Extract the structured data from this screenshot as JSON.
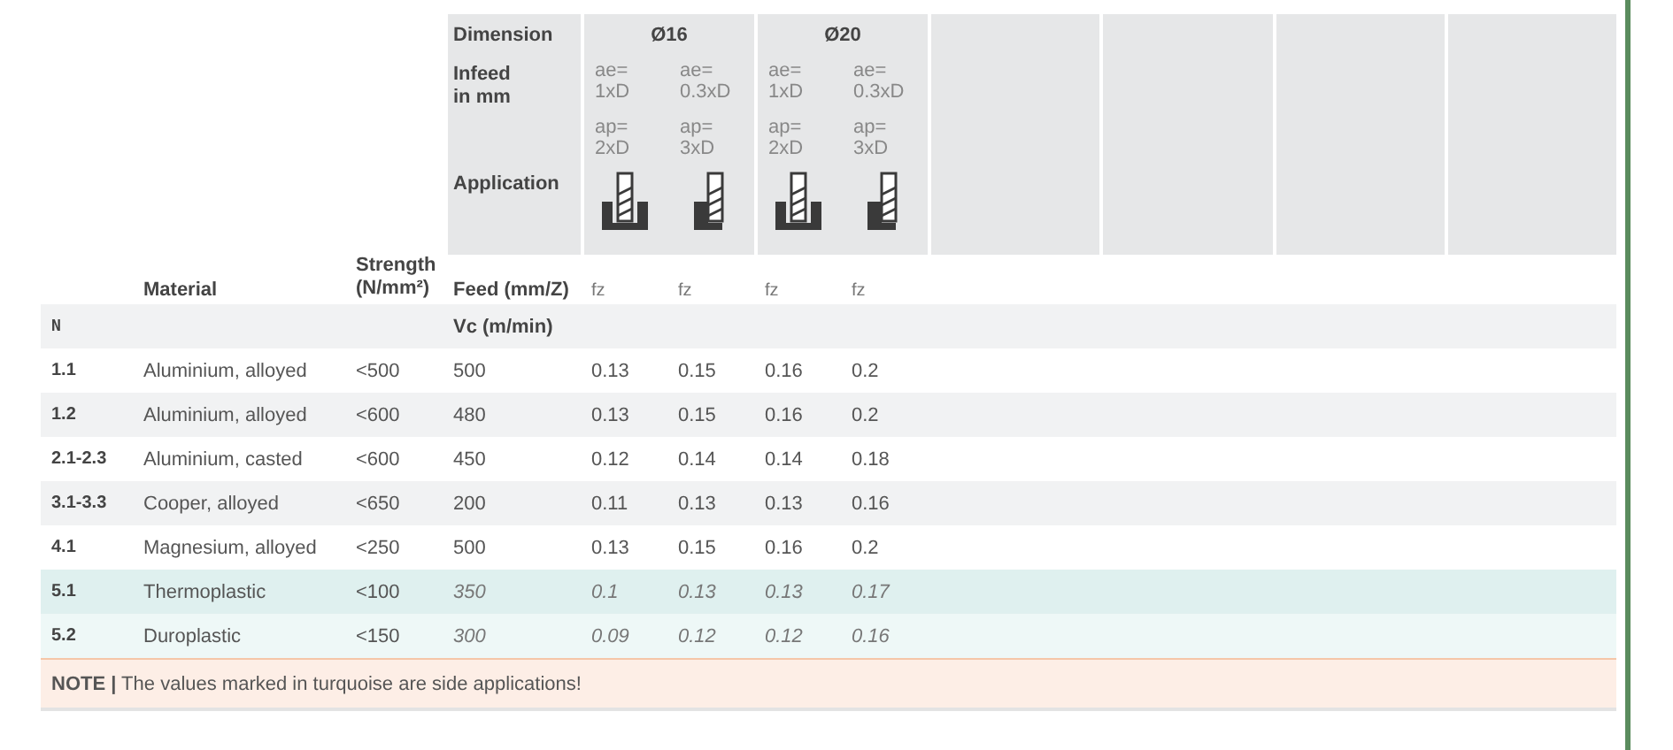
{
  "header": {
    "dimension_label": "Dimension",
    "infeed_label": "Infeed\nin mm",
    "application_label": "Application",
    "groups": [
      {
        "title": "Ø16",
        "columns": [
          {
            "ae": "ae=\n1xD",
            "ap": "ap=\n2xD",
            "application": {
              "kind": "slot"
            }
          },
          {
            "ae": "ae=\n0.3xD",
            "ap": "ap=\n3xD",
            "application": {
              "kind": "shoulder"
            }
          }
        ]
      },
      {
        "title": "Ø20",
        "columns": [
          {
            "ae": "ae=\n1xD",
            "ap": "ap=\n2xD",
            "application": {
              "kind": "slot"
            }
          },
          {
            "ae": "ae=\n0.3xD",
            "ap": "ap=\n3xD",
            "application": {
              "kind": "shoulder"
            }
          }
        ]
      }
    ]
  },
  "feed_row": {
    "material_label": "Material",
    "strength_label": "Strength\n(N/mm²)",
    "feed_label": "Feed (mm/Z)",
    "units": [
      "fz",
      "fz",
      "fz",
      "fz"
    ]
  },
  "section_row": {
    "code": "N",
    "vc_label": "Vc (m/min)"
  },
  "rows": [
    {
      "code": "1.1",
      "material": "Aluminium, alloyed",
      "strength": "<500",
      "vc": "500",
      "values": [
        "0.13",
        "0.15",
        "0.16",
        "0.2"
      ],
      "kind": "normal"
    },
    {
      "code": "1.2",
      "material": "Aluminium, alloyed",
      "strength": "<600",
      "vc": "480",
      "values": [
        "0.13",
        "0.15",
        "0.16",
        "0.2"
      ],
      "kind": "normal"
    },
    {
      "code": "2.1-2.3",
      "material": "Aluminium, casted",
      "strength": "<600",
      "vc": "450",
      "values": [
        "0.12",
        "0.14",
        "0.14",
        "0.18"
      ],
      "kind": "normal"
    },
    {
      "code": "3.1-3.3",
      "material": "Cooper, alloyed",
      "strength": "<650",
      "vc": "200",
      "values": [
        "0.11",
        "0.13",
        "0.13",
        "0.16"
      ],
      "kind": "normal"
    },
    {
      "code": "4.1",
      "material": "Magnesium, alloyed",
      "strength": "<250",
      "vc": "500",
      "values": [
        "0.13",
        "0.15",
        "0.16",
        "0.2"
      ],
      "kind": "normal"
    },
    {
      "code": "5.1",
      "material": "Thermoplastic",
      "strength": "<100",
      "vc": "350",
      "values": [
        "0.1",
        "0.13",
        "0.13",
        "0.17"
      ],
      "kind": "side"
    },
    {
      "code": "5.2",
      "material": "Duroplastic",
      "strength": "<150",
      "vc": "300",
      "values": [
        "0.09",
        "0.12",
        "0.12",
        "0.16"
      ],
      "kind": "side"
    }
  ],
  "note": "**NOTE |** The values marked in turquoise are side applications!"
}
